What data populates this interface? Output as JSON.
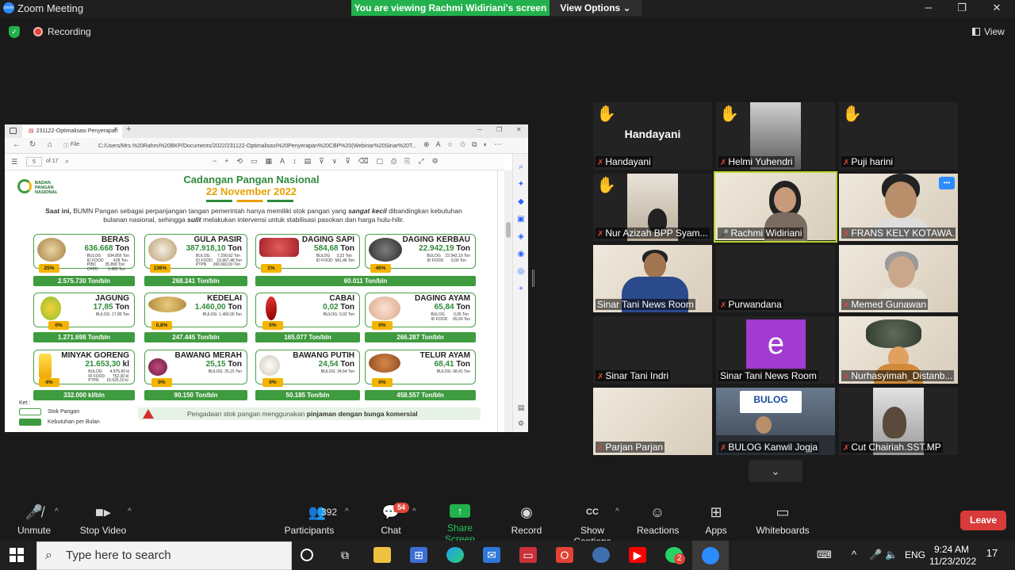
{
  "window": {
    "title": "Zoom Meeting",
    "minimize": "─",
    "restore": "❐",
    "close": "✕"
  },
  "banner": {
    "viewing": "You are viewing Rachmi Widiriani's screen",
    "view_options": "View Options ⌄"
  },
  "status": {
    "recording": "Recording",
    "view": "View"
  },
  "browser": {
    "tab_title": "231122-Optimalisasi Penyerapan",
    "tab_close": "✕",
    "new_tab": "+",
    "url_prefix": "File",
    "url": "C:/Users/Mrs.%20Rahmi%20BKP/Documents/2022/231122-Optimalisasi%20Penyerapan%20CBP%20(Webinar%20Sinar%20T...",
    "page_current": "5",
    "page_total": "of 17"
  },
  "slide": {
    "logo": "BADAN PANGAN NASIONAL",
    "title": "Cadangan Pangan Nasional",
    "date": "22 November 2022",
    "intro_1": "Saat ini,",
    "intro_2": " BUMN Pangan sebagai perpanjangan tangan pemerintah hanya memiliki stok pangan yang ",
    "intro_3": "sangat kecil",
    "intro_4": " dibandingkan kebutuhan bulanan nasional, sehingga ",
    "intro_5": "sulit",
    "intro_6": " melakukan intervensi untuk stabilisasi pasokan dan harga hulu-hilir.",
    "commodities": [
      {
        "name": "BERAS",
        "value": "636.668",
        "unit": "Ton",
        "details": "BULOG      594.856 Ton\nID FOOD         428 Ton\nPIBC        35.899 Ton\nCPPD         5.485 Ton",
        "pct": "25%",
        "need": "2.575.730 Ton/bln"
      },
      {
        "name": "GULA PASIR",
        "value": "387.918,10",
        "unit": "Ton",
        "details": "BULOG       7.290,62 Ton\nID FOOD    19.967,48 Ton\nPTPN      360.660,00 Ton",
        "pct": "136%",
        "need": "268.241 Ton/bln"
      },
      {
        "name": "DAGING SAPI",
        "value": "584,68",
        "unit": "Ton",
        "details": "BULOG      3,22 Ton\nID FOOD  581,46 Ton",
        "pct": "1%",
        "need": ""
      },
      {
        "name": "DAGING KERBAU",
        "value": "22.942,19",
        "unit": "Ton",
        "details": "BULOG    22.942,19 Ton\nID FOOD       0,00 Ton",
        "pct": "46%",
        "need": "60.011 Ton/bln"
      },
      {
        "name": "JAGUNG",
        "value": "17,85",
        "unit": "Ton",
        "details": "BULOG: 17,85 Ton",
        "pct": "0%",
        "need": "1.271.698 Ton/bln"
      },
      {
        "name": "KEDELAI",
        "value": "1.460,00",
        "unit": "Ton",
        "details": "BULOG: 1.460,00 Ton",
        "pct": "0,8%",
        "need": "247.445 Ton/bln"
      },
      {
        "name": "CABAI",
        "value": "0,02",
        "unit": "Ton",
        "details": "BULOG: 0,02 Ton",
        "pct": "0%",
        "need": "165.077 Ton/bln"
      },
      {
        "name": "DAGING AYAM",
        "value": "65,84",
        "unit": "Ton",
        "details": "BULOG        0,05 Ton\nID FOOD     65,69 Ton",
        "pct": "0%",
        "need": "266.287 Ton/bln"
      },
      {
        "name": "MINYAK GORENG",
        "value": "21.653,30",
        "unit": "kl",
        "details": "BULOG       4.975,90 kl\nID FOOD       752,30 kl\nPTPN       15.925,10 kl",
        "pct": "4%",
        "need": "332.000 kl/bln"
      },
      {
        "name": "BAWANG MERAH",
        "value": "25,15",
        "unit": "Ton",
        "details": "BULOG: 25,15 Ton",
        "pct": "0%",
        "need": "90.150 Ton/bln"
      },
      {
        "name": "BAWANG PUTIH",
        "value": "24,54",
        "unit": "Ton",
        "details": "BULOG: 24,54 Ton",
        "pct": "0%",
        "need": "50.185 Ton/bln"
      },
      {
        "name": "TELUR AYAM",
        "value": "68,41",
        "unit": "Ton",
        "details": "BULOG: 68,41 Ton",
        "pct": "0%",
        "need": "458.557 Ton/bln"
      }
    ],
    "legend_title": "Ket :",
    "legend_stock": "Stok Pangan",
    "legend_need": "Kebutuhan per Bulan",
    "note_1": "Pengadaan stok pangan menggunakan ",
    "note_2": "pinjaman dengan bunga komersial"
  },
  "participants_tiles": [
    "Handayani",
    "Helmi Yuhendri",
    "Puji harini",
    "Nur Azizah BPP Syam...",
    "Rachmi Widiriani",
    "FRANS KELY KOTAWA...",
    "Sinar Tani News Room",
    "Purwandana",
    "Memed Gunawan",
    "Sinar Tani Indri",
    "Sinar Tani News Room",
    "Nurhasyimah_Distanb...",
    "Parjan Parjan",
    "BULOG Kanwil Jogja",
    "Cut Chairiah.SST.MP"
  ],
  "tile_extra": {
    "handayani_center": "Handayani",
    "avatar_letter": "e",
    "bulog_sign": "BULOG",
    "more": "⌄",
    "tile_more": "•••"
  },
  "toolbar": {
    "unmute": "Unmute",
    "stop_video": "Stop Video",
    "participants": "Participants",
    "participant_count": "392",
    "chat": "Chat",
    "chat_badge": "54",
    "share_screen": "Share Screen",
    "record": "Record",
    "captions": "Show Captions",
    "reactions": "Reactions",
    "apps": "Apps",
    "whiteboards": "Whiteboards",
    "leave": "Leave"
  },
  "taskbar": {
    "search_placeholder": "Type here to search",
    "lang": "ENG",
    "time": "9:24 AM",
    "date": "11/23/2022",
    "notif": "17",
    "whatsapp_badge": "2"
  },
  "colors": {
    "zoom_green": "#22b14c",
    "leave_red": "#d93a3a",
    "slide_green": "#3f9b3f",
    "slide_gold": "#f4b400",
    "speaker_border": "#b8d62c"
  }
}
